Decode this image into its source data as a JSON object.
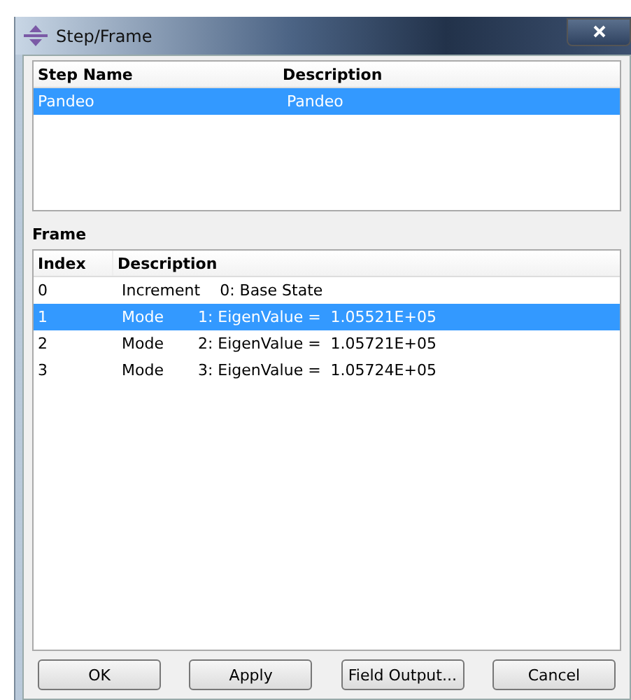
{
  "window": {
    "title": "Step/Frame"
  },
  "steps": {
    "columns": [
      "Step Name",
      "Description"
    ],
    "rows": [
      {
        "cells": [
          "Pandeo",
          "Pandeo"
        ],
        "selected": true
      }
    ]
  },
  "frame": {
    "label": "Frame",
    "columns": [
      "Index",
      "Description"
    ],
    "rows": [
      {
        "cells": [
          "0",
          "Increment    0: Base State"
        ],
        "selected": false
      },
      {
        "cells": [
          "1",
          "Mode       1: EigenValue =  1.05521E+05"
        ],
        "selected": true
      },
      {
        "cells": [
          "2",
          "Mode       2: EigenValue =  1.05721E+05"
        ],
        "selected": false
      },
      {
        "cells": [
          "3",
          "Mode       3: EigenValue =  1.05724E+05"
        ],
        "selected": false
      }
    ]
  },
  "buttons": [
    "OK",
    "Apply",
    "Field Output...",
    "Cancel"
  ]
}
